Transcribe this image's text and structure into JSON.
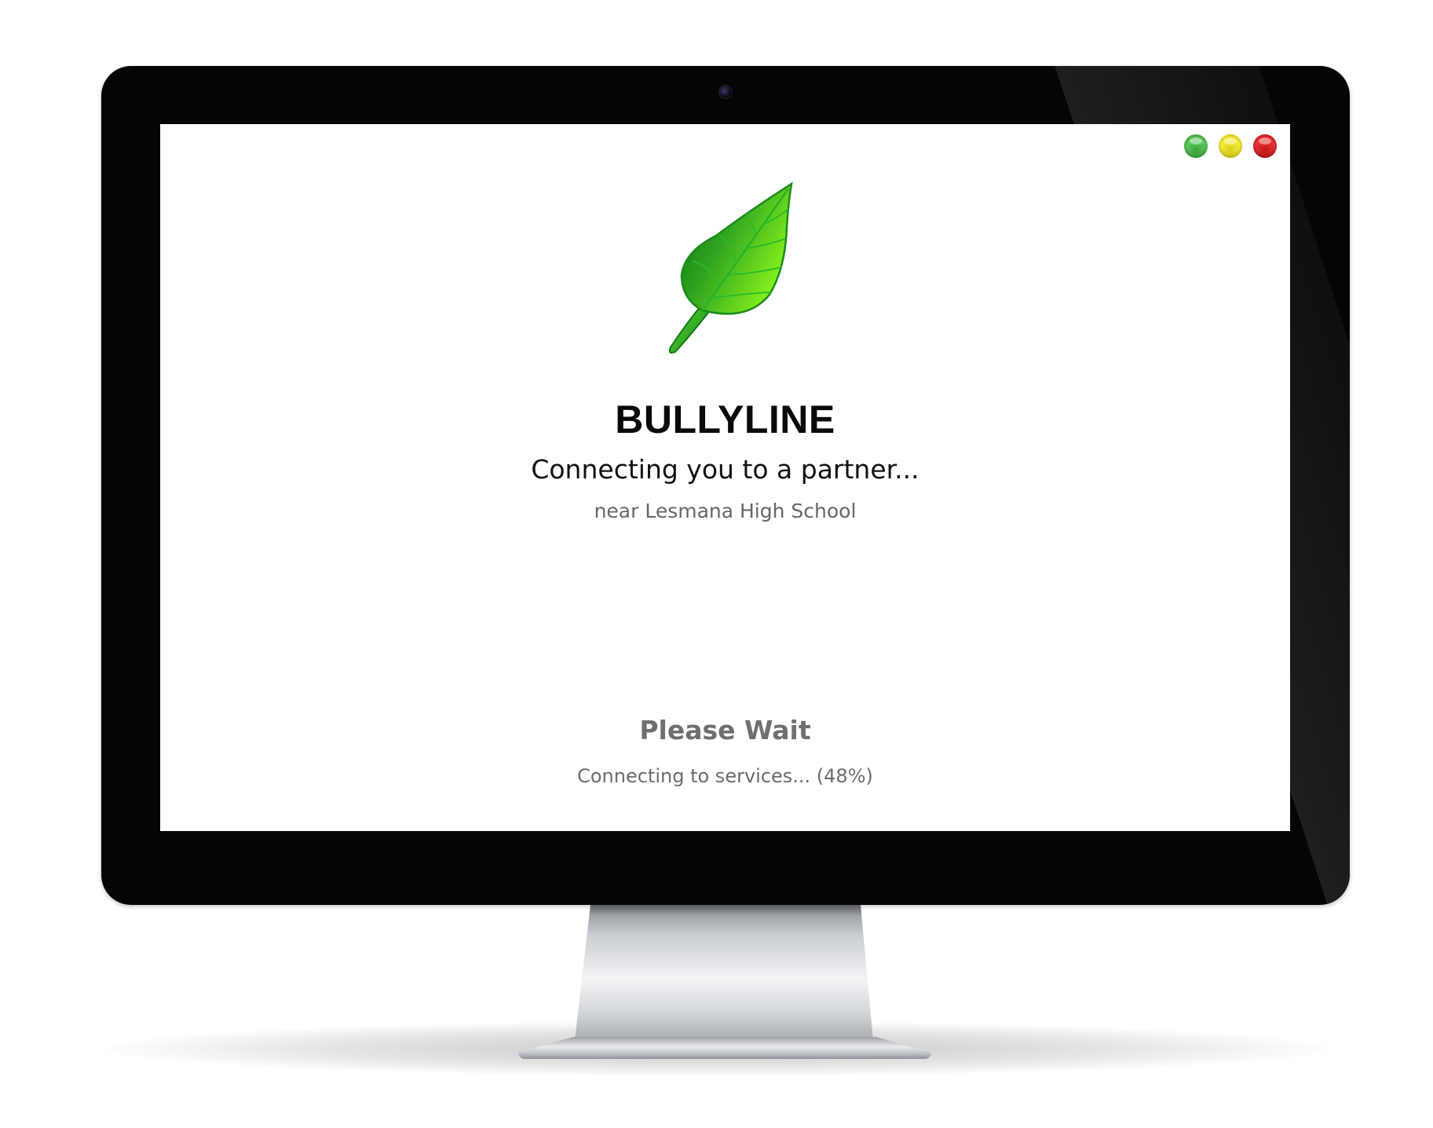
{
  "window_controls": {
    "buttons": [
      {
        "name": "green",
        "color": "#4cb84c"
      },
      {
        "name": "yellow",
        "color": "#f0e62e"
      },
      {
        "name": "red",
        "color": "#e22b2b"
      }
    ]
  },
  "app": {
    "logo_icon": "leaf-icon",
    "title": "BULLYLINE",
    "subtitle": "Connecting you to a partner...",
    "location": "near Lesmana High School"
  },
  "loading": {
    "heading": "Please Wait",
    "status": "Connecting to services... (48%)",
    "progress_percent": 48
  },
  "colors": {
    "leaf_dark": "#0e7a12",
    "leaf_light": "#7ff21a",
    "title": "#0a0a0a",
    "muted_text": "#6b6b6b"
  }
}
